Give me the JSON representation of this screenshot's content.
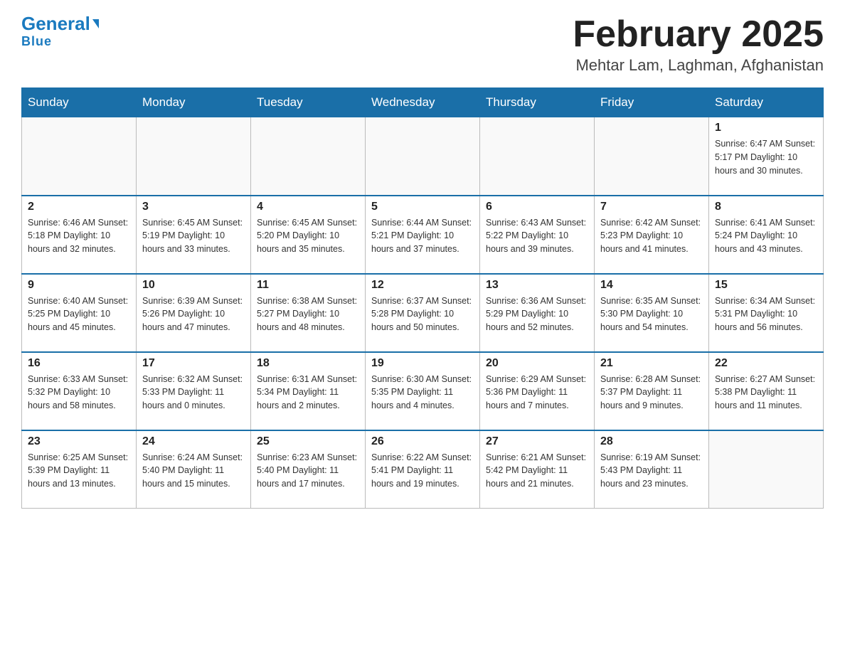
{
  "logo": {
    "name_part1": "General",
    "name_part2": "Blue"
  },
  "title": "February 2025",
  "subtitle": "Mehtar Lam, Laghman, Afghanistan",
  "weekdays": [
    "Sunday",
    "Monday",
    "Tuesday",
    "Wednesday",
    "Thursday",
    "Friday",
    "Saturday"
  ],
  "weeks": [
    [
      {
        "day": "",
        "info": ""
      },
      {
        "day": "",
        "info": ""
      },
      {
        "day": "",
        "info": ""
      },
      {
        "day": "",
        "info": ""
      },
      {
        "day": "",
        "info": ""
      },
      {
        "day": "",
        "info": ""
      },
      {
        "day": "1",
        "info": "Sunrise: 6:47 AM\nSunset: 5:17 PM\nDaylight: 10 hours\nand 30 minutes."
      }
    ],
    [
      {
        "day": "2",
        "info": "Sunrise: 6:46 AM\nSunset: 5:18 PM\nDaylight: 10 hours\nand 32 minutes."
      },
      {
        "day": "3",
        "info": "Sunrise: 6:45 AM\nSunset: 5:19 PM\nDaylight: 10 hours\nand 33 minutes."
      },
      {
        "day": "4",
        "info": "Sunrise: 6:45 AM\nSunset: 5:20 PM\nDaylight: 10 hours\nand 35 minutes."
      },
      {
        "day": "5",
        "info": "Sunrise: 6:44 AM\nSunset: 5:21 PM\nDaylight: 10 hours\nand 37 minutes."
      },
      {
        "day": "6",
        "info": "Sunrise: 6:43 AM\nSunset: 5:22 PM\nDaylight: 10 hours\nand 39 minutes."
      },
      {
        "day": "7",
        "info": "Sunrise: 6:42 AM\nSunset: 5:23 PM\nDaylight: 10 hours\nand 41 minutes."
      },
      {
        "day": "8",
        "info": "Sunrise: 6:41 AM\nSunset: 5:24 PM\nDaylight: 10 hours\nand 43 minutes."
      }
    ],
    [
      {
        "day": "9",
        "info": "Sunrise: 6:40 AM\nSunset: 5:25 PM\nDaylight: 10 hours\nand 45 minutes."
      },
      {
        "day": "10",
        "info": "Sunrise: 6:39 AM\nSunset: 5:26 PM\nDaylight: 10 hours\nand 47 minutes."
      },
      {
        "day": "11",
        "info": "Sunrise: 6:38 AM\nSunset: 5:27 PM\nDaylight: 10 hours\nand 48 minutes."
      },
      {
        "day": "12",
        "info": "Sunrise: 6:37 AM\nSunset: 5:28 PM\nDaylight: 10 hours\nand 50 minutes."
      },
      {
        "day": "13",
        "info": "Sunrise: 6:36 AM\nSunset: 5:29 PM\nDaylight: 10 hours\nand 52 minutes."
      },
      {
        "day": "14",
        "info": "Sunrise: 6:35 AM\nSunset: 5:30 PM\nDaylight: 10 hours\nand 54 minutes."
      },
      {
        "day": "15",
        "info": "Sunrise: 6:34 AM\nSunset: 5:31 PM\nDaylight: 10 hours\nand 56 minutes."
      }
    ],
    [
      {
        "day": "16",
        "info": "Sunrise: 6:33 AM\nSunset: 5:32 PM\nDaylight: 10 hours\nand 58 minutes."
      },
      {
        "day": "17",
        "info": "Sunrise: 6:32 AM\nSunset: 5:33 PM\nDaylight: 11 hours\nand 0 minutes."
      },
      {
        "day": "18",
        "info": "Sunrise: 6:31 AM\nSunset: 5:34 PM\nDaylight: 11 hours\nand 2 minutes."
      },
      {
        "day": "19",
        "info": "Sunrise: 6:30 AM\nSunset: 5:35 PM\nDaylight: 11 hours\nand 4 minutes."
      },
      {
        "day": "20",
        "info": "Sunrise: 6:29 AM\nSunset: 5:36 PM\nDaylight: 11 hours\nand 7 minutes."
      },
      {
        "day": "21",
        "info": "Sunrise: 6:28 AM\nSunset: 5:37 PM\nDaylight: 11 hours\nand 9 minutes."
      },
      {
        "day": "22",
        "info": "Sunrise: 6:27 AM\nSunset: 5:38 PM\nDaylight: 11 hours\nand 11 minutes."
      }
    ],
    [
      {
        "day": "23",
        "info": "Sunrise: 6:25 AM\nSunset: 5:39 PM\nDaylight: 11 hours\nand 13 minutes."
      },
      {
        "day": "24",
        "info": "Sunrise: 6:24 AM\nSunset: 5:40 PM\nDaylight: 11 hours\nand 15 minutes."
      },
      {
        "day": "25",
        "info": "Sunrise: 6:23 AM\nSunset: 5:40 PM\nDaylight: 11 hours\nand 17 minutes."
      },
      {
        "day": "26",
        "info": "Sunrise: 6:22 AM\nSunset: 5:41 PM\nDaylight: 11 hours\nand 19 minutes."
      },
      {
        "day": "27",
        "info": "Sunrise: 6:21 AM\nSunset: 5:42 PM\nDaylight: 11 hours\nand 21 minutes."
      },
      {
        "day": "28",
        "info": "Sunrise: 6:19 AM\nSunset: 5:43 PM\nDaylight: 11 hours\nand 23 minutes."
      },
      {
        "day": "",
        "info": ""
      }
    ]
  ]
}
